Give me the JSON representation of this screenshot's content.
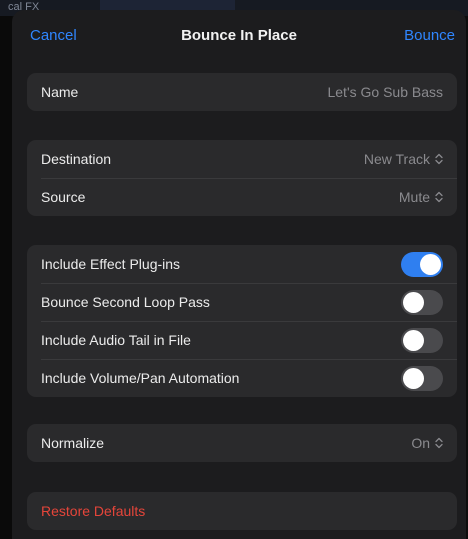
{
  "background": {
    "text": "cal FX"
  },
  "header": {
    "cancel_label": "Cancel",
    "title": "Bounce In Place",
    "bounce_label": "Bounce"
  },
  "name_group": {
    "label": "Name",
    "value": "Let's Go Sub Bass"
  },
  "routing": {
    "destination": {
      "label": "Destination",
      "value": "New Track"
    },
    "source": {
      "label": "Source",
      "value": "Mute"
    }
  },
  "options": [
    {
      "label": "Include Effect Plug-ins",
      "enabled": true
    },
    {
      "label": "Bounce Second Loop Pass",
      "enabled": false
    },
    {
      "label": "Include Audio Tail in File",
      "enabled": false
    },
    {
      "label": "Include Volume/Pan Automation",
      "enabled": false
    }
  ],
  "normalize": {
    "label": "Normalize",
    "value": "On"
  },
  "restore_defaults_label": "Restore Defaults",
  "colors": {
    "accent": "#2f86ff",
    "toggle_on": "#2f7ff0",
    "destructive": "#e5453a"
  },
  "icons": {
    "popup": "updown-chevron-icon"
  }
}
